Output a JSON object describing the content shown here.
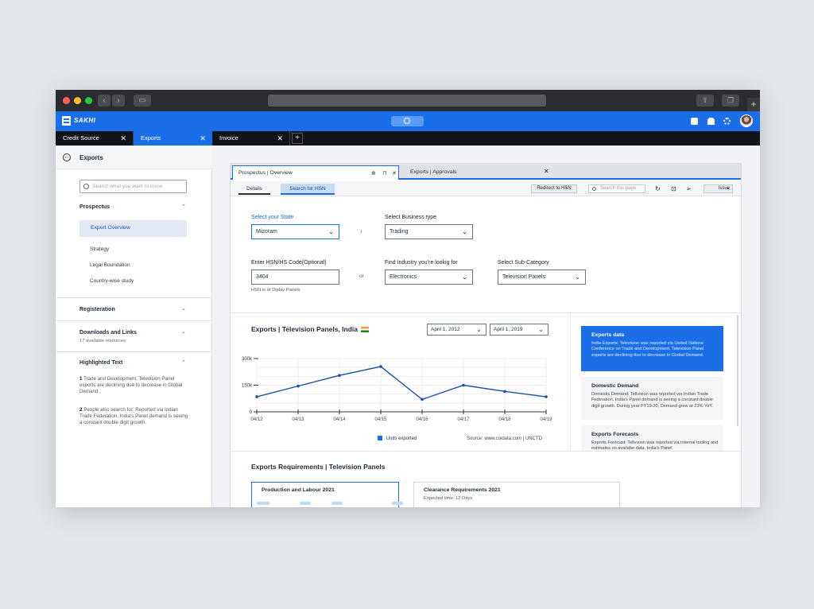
{
  "app": {
    "brand": "SAKHI"
  },
  "tabs": [
    {
      "label": "Credit Source"
    },
    {
      "label": "Exports"
    },
    {
      "label": "Invoice"
    }
  ],
  "sidebar": {
    "title": "Exports",
    "search_placeholder": "Search what you want to know",
    "prospectus": {
      "label": "Prospectus",
      "items": [
        "Export Overview",
        "Strategy",
        "Legal Boundation",
        "Country-wise study"
      ]
    },
    "registration": {
      "label": "Registeration"
    },
    "downloads": {
      "label": "Downloads and Links",
      "sub": "17 available resources"
    },
    "highlighted": {
      "label": "Highlighted Text",
      "items": [
        {
          "num": "1",
          "text": "Trade and Development. Television Panel exports are declining due to decrease in Global Demand."
        },
        {
          "num": "2",
          "text": "People also search for: Reported via Indian Trade Federation. India's Panel demand is seeing a constant double digit growth."
        }
      ]
    }
  },
  "panel": {
    "tab1": "Prospectus | Overview",
    "tab2": "Exports | Approvals",
    "subtabs": [
      "Details",
      "Search for HSN"
    ],
    "redirect_label": "Redirect to HSN",
    "search_placeholder": "Search this page",
    "issue_label": "Issue"
  },
  "form": {
    "state_label": "Select your State",
    "state_value": "Mizoram",
    "business_label": "Select Business type",
    "business_value": "Trading",
    "hsn_label": "Enter HSN/HS Code(Optional)",
    "hsn_value": "3404",
    "hsn_hint": "HSN is of Diplay Panels",
    "or_label": "or",
    "industry_label": "Find Industry you're lookig for",
    "industry_value": "Electronics",
    "subcat_label": "Select Sub-Category",
    "subcat_value": "Television Panels"
  },
  "chart_section": {
    "title": "Exports | Television Panels, India",
    "date_from": "April 1, 2012",
    "date_to": "April 1, 2019",
    "legend": "Units exported",
    "source": "Source: www.coidata.com | UNCTD"
  },
  "chart_data": {
    "type": "line",
    "categories": [
      "04/12",
      "04/13",
      "04/14",
      "04/15",
      "04/16",
      "04/17",
      "04/18",
      "04/19"
    ],
    "series": [
      {
        "name": "Units exported",
        "values": [
          85,
          145,
          205,
          255,
          70,
          150,
          115,
          85
        ]
      }
    ],
    "yticks": [
      "300k",
      "150k",
      "0"
    ],
    "ylim": [
      0,
      300
    ],
    "grid": true,
    "color": "#1a4fa6"
  },
  "cards": [
    {
      "title": "Exports data",
      "body": "India Exports: Television was reported via United Nations Conference on Trade and Development. Television Panel exports are declining due to decrease in Global Demand."
    },
    {
      "title": "Domestic Demand",
      "body": "Domestic Demand: Tellvision was reported via Indian Trade Federation. India's Panel demand is seeing a constant double digit growth. During year FY19-20, Demand grew at 23% YoY."
    },
    {
      "title": "Exports Forecasts",
      "body": "Exports Forecast: Tellvision was reported via internal tooling and estimates on availabe data. India's Panel"
    }
  ],
  "requirements": {
    "title": "Exports Requirements | Television Panels",
    "cards": [
      {
        "title": "Production and Labour 2021"
      },
      {
        "title": "Clearance Requirements 2021",
        "sub": "Expected time: 12 Days"
      }
    ]
  },
  "colors": {
    "accent": "#1a6ee8",
    "dark": "#111418"
  }
}
